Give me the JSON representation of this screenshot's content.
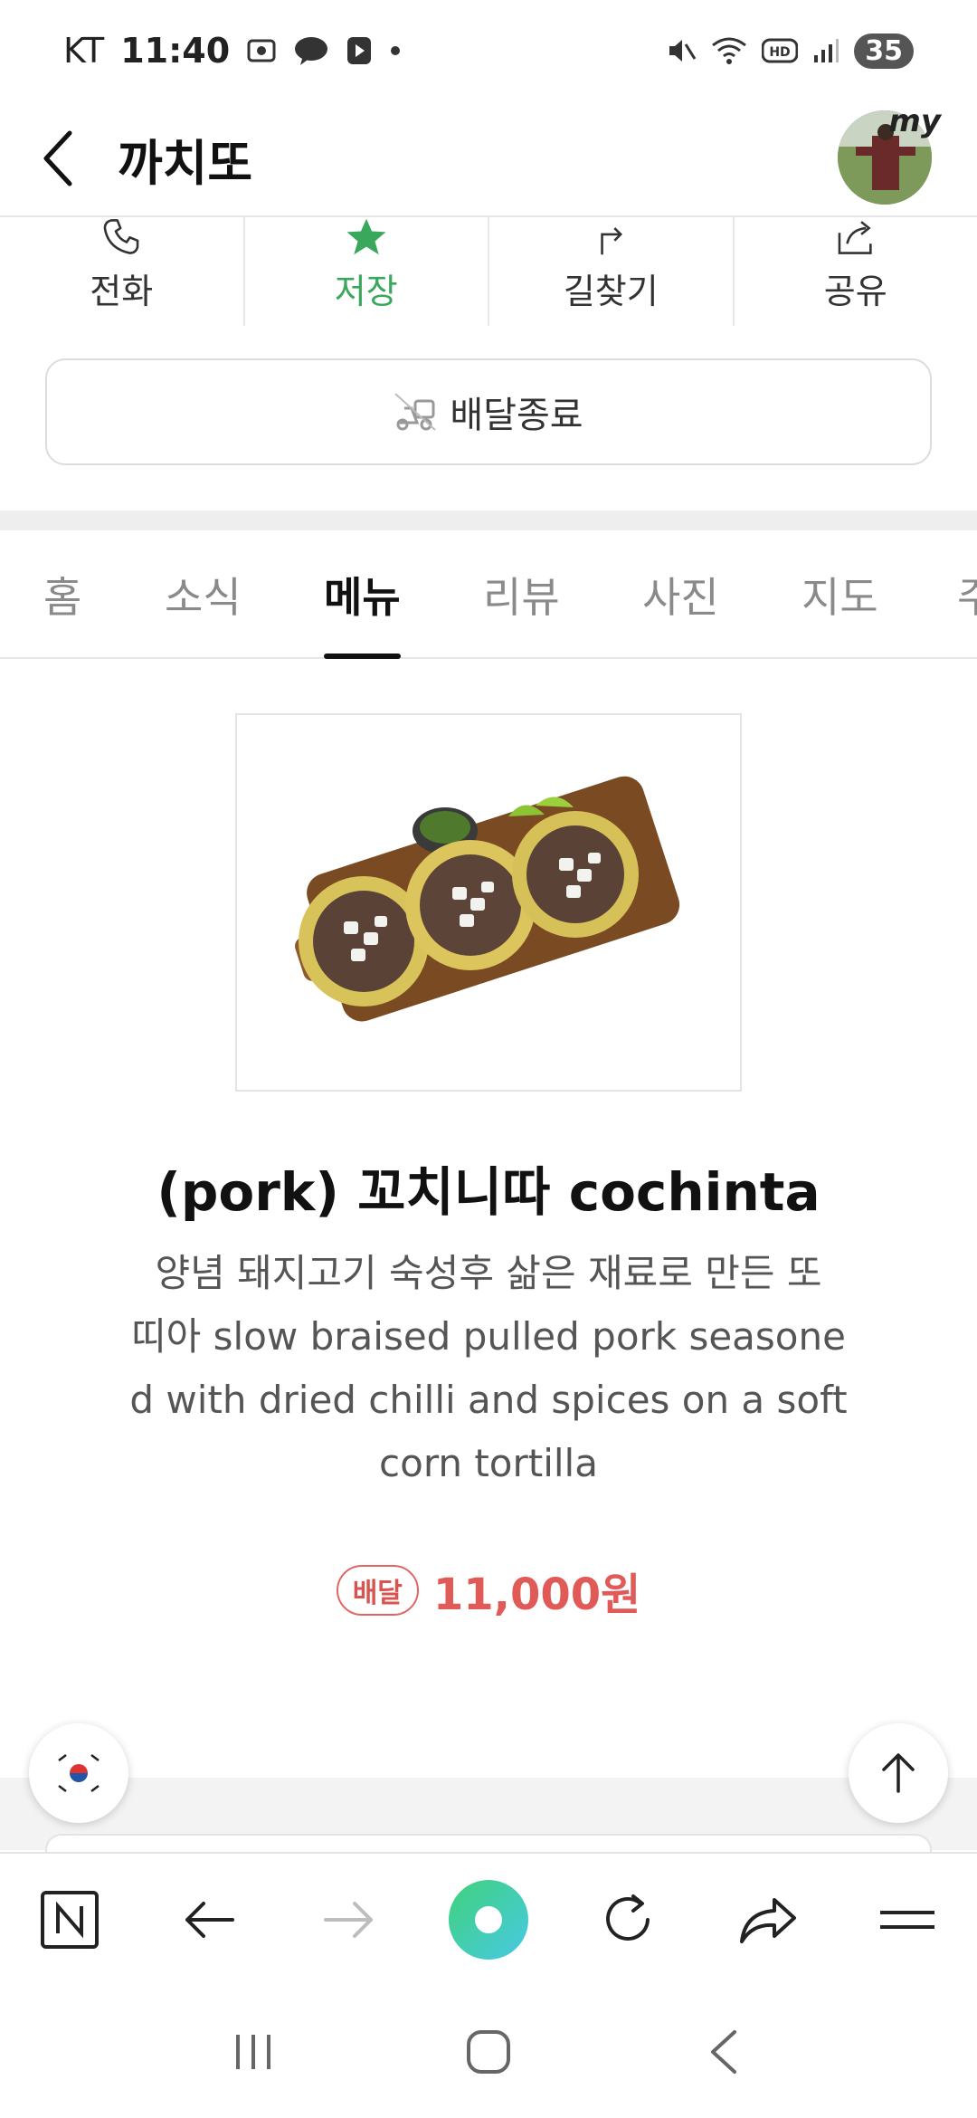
{
  "status_bar": {
    "carrier": "KT",
    "time": "11:40",
    "battery": "35"
  },
  "header": {
    "title": "까치또",
    "avatar_label": "my"
  },
  "actions": [
    {
      "label": "전화",
      "icon": "phone-icon"
    },
    {
      "label": "저장",
      "icon": "star-icon",
      "active": true
    },
    {
      "label": "길찾기",
      "icon": "directions-icon"
    },
    {
      "label": "공유",
      "icon": "share-icon"
    }
  ],
  "delivery": {
    "label": "배달종료",
    "icon": "delivery-scooter-icon"
  },
  "tabs": [
    {
      "label": "홈"
    },
    {
      "label": "소식"
    },
    {
      "label": "메뉴",
      "active": true
    },
    {
      "label": "리뷰"
    },
    {
      "label": "사진"
    },
    {
      "label": "지도"
    },
    {
      "label": "주"
    }
  ],
  "menu_item": {
    "name": "(pork) 꼬치니따 cochinta",
    "description_lines": [
      "양념 돼지고기 숙성후 삶은 재료로 만든 또",
      "띠아 slow braised pulled pork seasone",
      "d with dried chilli and spices on a soft",
      "corn tortilla"
    ],
    "badge": "배달",
    "price": "11,000원"
  },
  "colors": {
    "accent_green": "#3aa85c",
    "price_red": "#e05a57"
  }
}
